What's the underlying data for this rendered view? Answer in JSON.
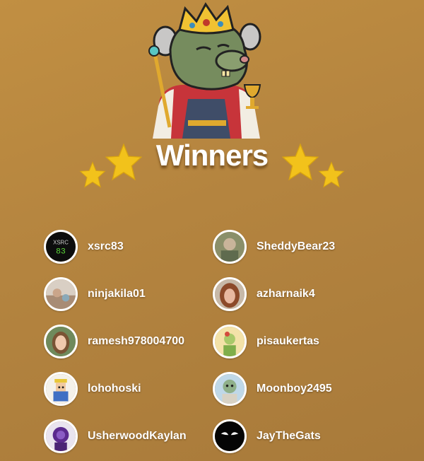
{
  "header": {
    "title": "Winners"
  },
  "icons": {
    "mascot": "crowned-rat-king-illustration",
    "star": "gold-star-icon"
  },
  "colors": {
    "background": "#b8873f",
    "star": "#f2c21b",
    "text": "#ffffff"
  },
  "winners": [
    {
      "username": "xsrc83",
      "avatar": "xsrc-logo-avatar"
    },
    {
      "username": "SheddyBear23",
      "avatar": "photo-avatar"
    },
    {
      "username": "ninjakila01",
      "avatar": "photo-avatar"
    },
    {
      "username": "azharnaik4",
      "avatar": "photo-avatar"
    },
    {
      "username": "ramesh978004700",
      "avatar": "photo-avatar"
    },
    {
      "username": "pisaukertas",
      "avatar": "cartoon-avatar"
    },
    {
      "username": "lohohoski",
      "avatar": "pixel-art-avatar"
    },
    {
      "username": "Moonboy2495",
      "avatar": "cartoon-avatar"
    },
    {
      "username": "UsherwoodKaylan",
      "avatar": "purple-character-avatar"
    },
    {
      "username": "JayTheGats",
      "avatar": "dark-eyes-avatar"
    }
  ]
}
